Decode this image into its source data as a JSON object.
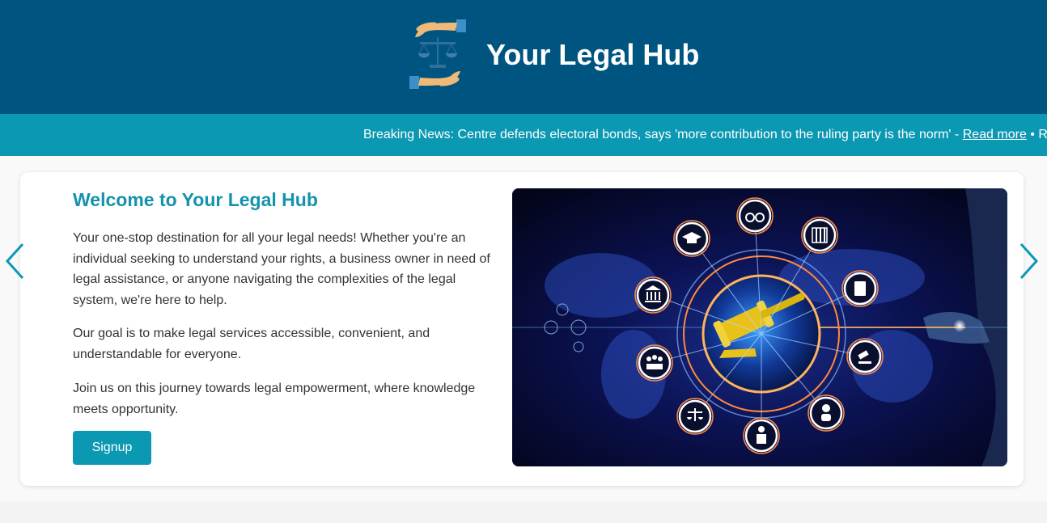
{
  "header": {
    "title": "Your Legal Hub",
    "logo_icon": "scales-in-hands-icon",
    "bg_color": "#005580"
  },
  "ticker": {
    "prefix": "Breaking News: Centre defends electoral bonds, says 'more contribution to the ruling party is the norm' - ",
    "link_label": "Read more",
    "suffix": " • R",
    "bg_color": "#0b98b3"
  },
  "welcome": {
    "title": "Welcome to Your Legal Hub",
    "paragraphs": [
      "Your one-stop destination for all your legal needs! Whether you're an individual seeking to understand your rights, a business owner in need of legal assistance, or anyone navigating the complexities of the legal system, we're here to help.",
      "Our goal is to make legal services accessible, convenient, and understandable for everyone.",
      "Join us on this journey towards legal empowerment, where knowledge meets opportunity."
    ],
    "signup_label": "Signup"
  },
  "hero": {
    "image": "legal-technology-gavel-globe-illustration"
  },
  "carousel": {
    "prev_icon": "chevron-left-icon",
    "next_icon": "chevron-right-icon"
  }
}
